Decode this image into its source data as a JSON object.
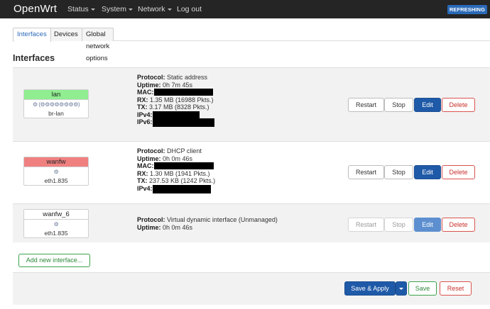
{
  "app": {
    "brand": "OpenWrt",
    "status_badge": "REFRESHING"
  },
  "nav": [
    {
      "label": "Status",
      "dropdown": true
    },
    {
      "label": "System",
      "dropdown": true
    },
    {
      "label": "Network",
      "dropdown": true
    },
    {
      "label": "Log out",
      "dropdown": false
    }
  ],
  "tabs": [
    {
      "label": "Interfaces",
      "active": true
    },
    {
      "label": "Devices",
      "active": false
    },
    {
      "label": "Global network options",
      "active": false
    }
  ],
  "page_title": "Interfaces",
  "interfaces": [
    {
      "name": "lan",
      "color": "#90ee90",
      "ports": "⚙ (⚙⚙⚙⚙⚙⚙⚙⚙)",
      "device": "br-lan",
      "info": {
        "protocol_label": "Protocol:",
        "protocol": "Static address",
        "uptime_label": "Uptime:",
        "uptime": "0h 7m 45s",
        "mac_label": "MAC:",
        "rx_label": "RX:",
        "rx": "1.35 MB (16988 Pkts.)",
        "tx_label": "TX:",
        "tx": "3.17 MB (8328 Pkts.)",
        "ipv4_label": "IPv4:",
        "ipv6_label": "IPv6:"
      }
    },
    {
      "name": "wanfw",
      "color": "#f08080",
      "ports": "⚙",
      "device": "eth1.835",
      "info": {
        "protocol_label": "Protocol:",
        "protocol": "DHCP client",
        "uptime_label": "Uptime:",
        "uptime": "0h 0m 46s",
        "mac_label": "MAC:",
        "rx_label": "RX:",
        "rx": "1.30 MB (1941 Pkts.)",
        "tx_label": "TX:",
        "tx": "237.53 KB (1242 Pkts.)",
        "ipv4_label": "IPv4:"
      }
    },
    {
      "name": "wanfw_6",
      "color": "#ffffff",
      "ports": "⚙",
      "device": "eth1.835",
      "info": {
        "protocol_label": "Protocol:",
        "protocol": "Virtual dynamic interface (Unmanaged)",
        "uptime_label": "Uptime:",
        "uptime": "0h 0m 46s"
      }
    }
  ],
  "row_buttons": {
    "restart": "Restart",
    "stop": "Stop",
    "edit": "Edit",
    "delete": "Delete"
  },
  "add_interface": "Add new interface...",
  "footer": {
    "save_apply": "Save & Apply",
    "save": "Save",
    "reset": "Reset"
  },
  "colors": {
    "primary": "#1f5aa8",
    "danger": "#d9534f",
    "success": "#3aa24c",
    "navbar": "#252525"
  }
}
